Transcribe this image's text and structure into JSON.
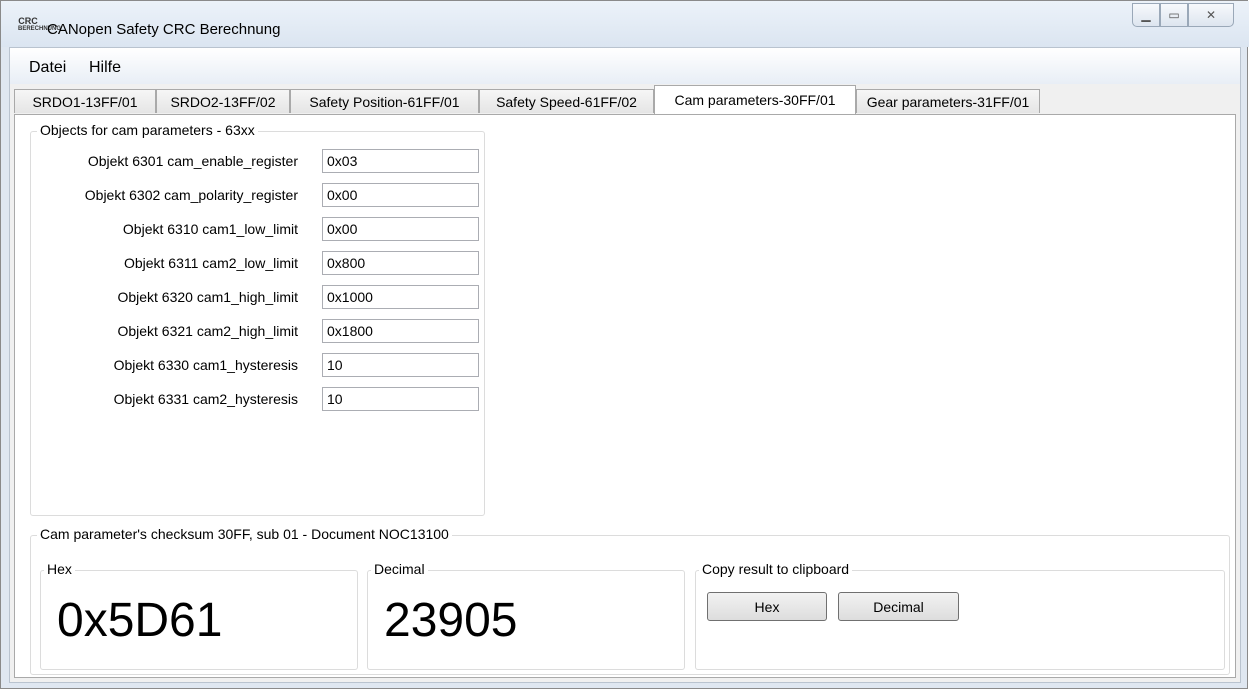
{
  "window": {
    "title": "CANopen Safety CRC Berechnung",
    "icon_text": [
      "CRC",
      "BERECHNUNG"
    ]
  },
  "menu": [
    {
      "label": "Datei"
    },
    {
      "label": "Hilfe"
    }
  ],
  "tabs": [
    {
      "label": "SRDO1-13FF/01"
    },
    {
      "label": "SRDO2-13FF/02"
    },
    {
      "label": "Safety Position-61FF/01"
    },
    {
      "label": "Safety Speed-61FF/02"
    },
    {
      "label": "Cam parameters-30FF/01",
      "active": true
    },
    {
      "label": "Gear parameters-31FF/01"
    }
  ],
  "objects_group": {
    "title": "Objects for cam parameters - 63xx",
    "rows": [
      {
        "label": "Objekt 6301 cam_enable_register",
        "value": "0x03"
      },
      {
        "label": "Objekt 6302 cam_polarity_register",
        "value": "0x00"
      },
      {
        "label": "Objekt 6310 cam1_low_limit",
        "value": "0x00"
      },
      {
        "label": "Objekt 6311 cam2_low_limit",
        "value": "0x800"
      },
      {
        "label": "Objekt 6320 cam1_high_limit",
        "value": "0x1000"
      },
      {
        "label": "Objekt 6321 cam2_high_limit",
        "value": "0x1800"
      },
      {
        "label": "Objekt 6330 cam1_hysteresis",
        "value": "10"
      },
      {
        "label": "Objekt 6331 cam2_hysteresis",
        "value": "10"
      }
    ]
  },
  "checksum_group": {
    "title": "Cam parameter's checksum 30FF, sub 01 - Document NOC13100",
    "hex": {
      "title": "Hex",
      "value": "0x5D61"
    },
    "decimal": {
      "title": "Decimal",
      "value": "23905"
    },
    "copy": {
      "title": "Copy result to clipboard",
      "hex_button": "Hex",
      "decimal_button": "Decimal"
    }
  }
}
